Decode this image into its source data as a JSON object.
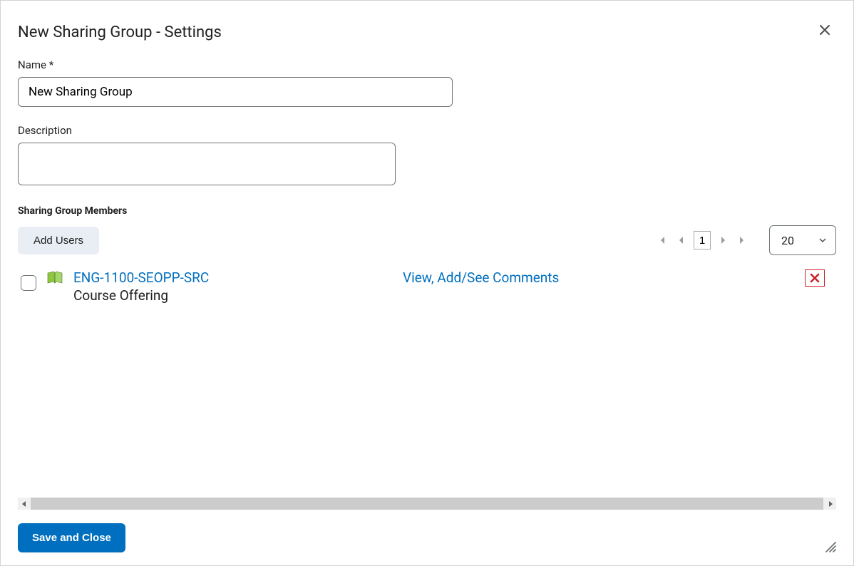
{
  "dialog": {
    "title": "New Sharing Group - Settings"
  },
  "fields": {
    "name_label": "Name *",
    "name_value": "New Sharing Group",
    "description_label": "Description",
    "description_value": ""
  },
  "members": {
    "section_label": "Sharing Group Members",
    "add_users_label": "Add Users",
    "pager": {
      "page_value": "1",
      "per_page": "20"
    },
    "rows": [
      {
        "title": "ENG-1100-SEOPP-SRC",
        "subtitle": "Course Offering",
        "permissions": "View, Add/See Comments"
      }
    ]
  },
  "footer": {
    "save_label": "Save and Close"
  }
}
